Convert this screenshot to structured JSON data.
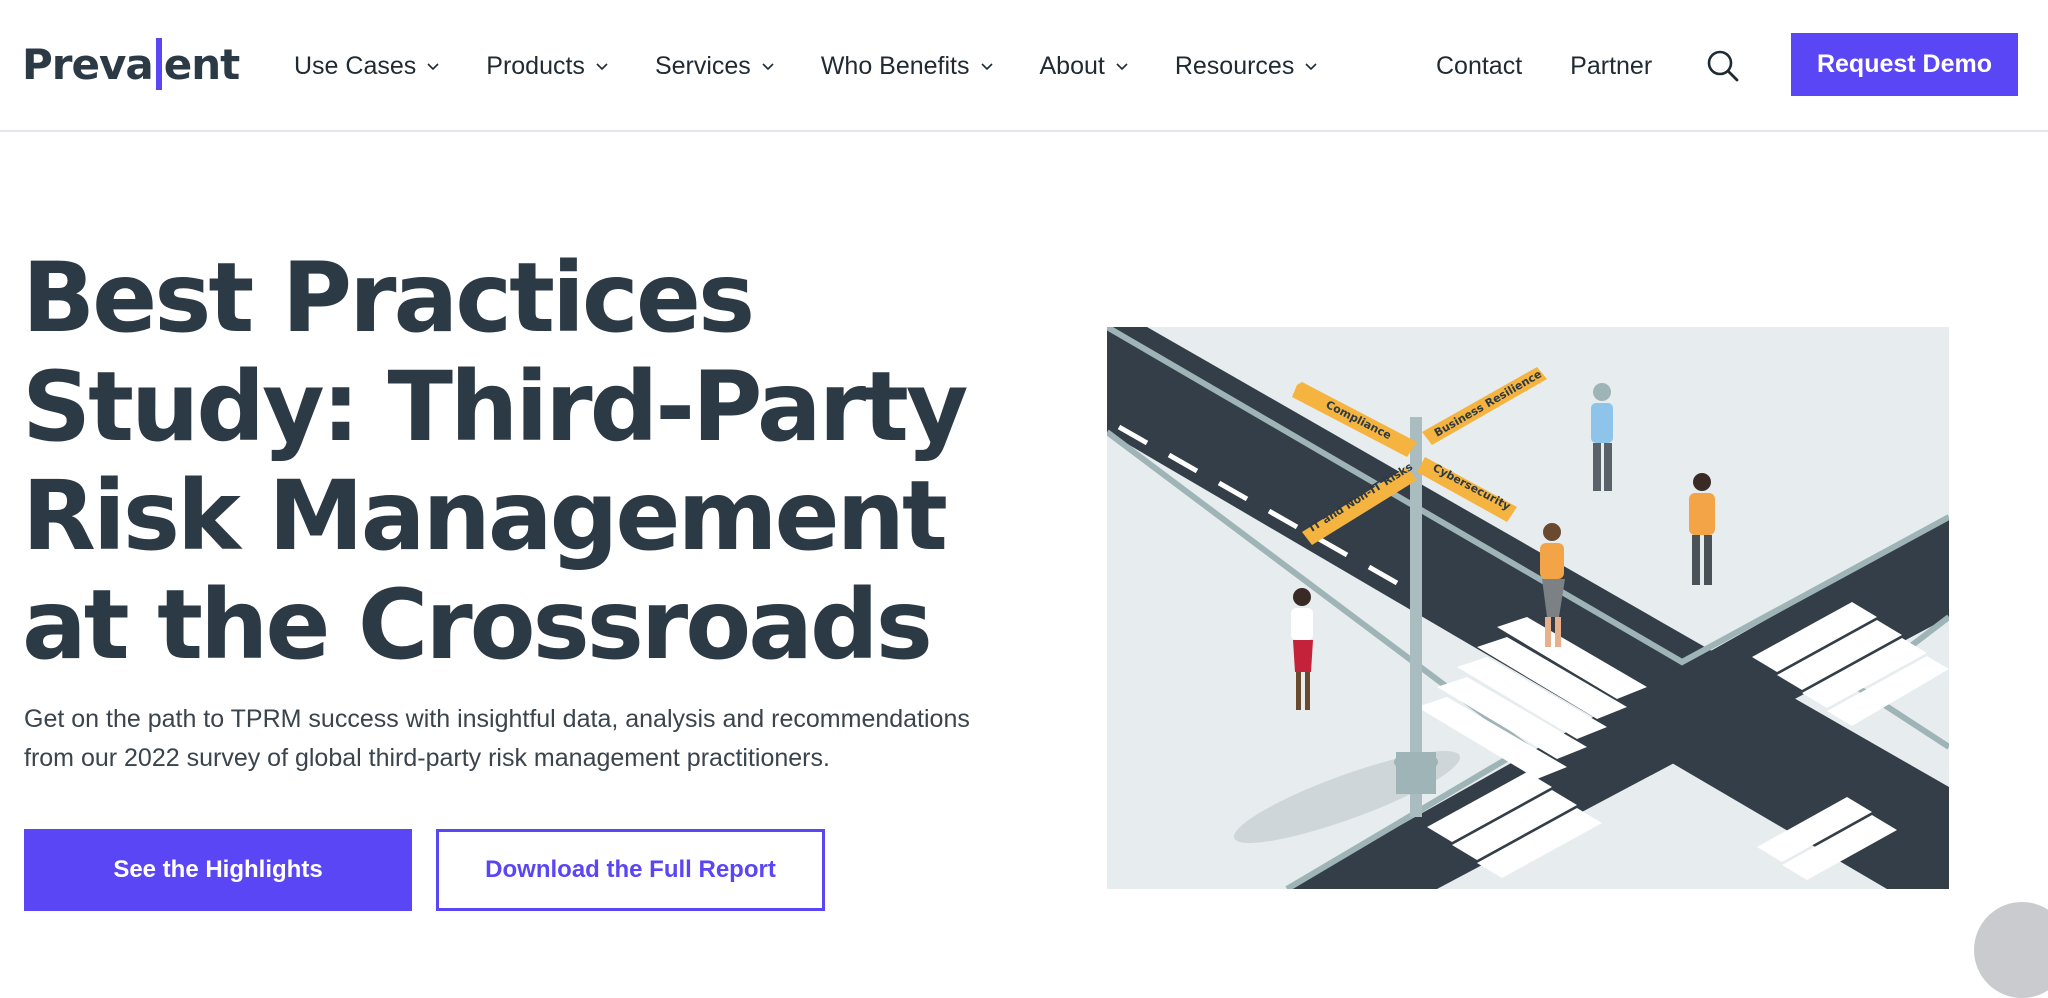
{
  "logo": {
    "part1": "Preva",
    "part2": "ent"
  },
  "nav": {
    "items": [
      {
        "label": "Use Cases"
      },
      {
        "label": "Products"
      },
      {
        "label": "Services"
      },
      {
        "label": "Who Benefits"
      },
      {
        "label": "About"
      },
      {
        "label": "Resources"
      }
    ],
    "contact": "Contact",
    "partner": "Partner",
    "cta": "Request Demo"
  },
  "hero": {
    "title": "Best Practices Study: Third-Party Risk Management at the Crossroads",
    "subtitle": "Get on the path to TPRM success with insightful data, analysis and recommendations from our 2022 survey of global third-party risk management practitioners.",
    "primary_button": "See the Highlights",
    "secondary_button": "Download the Full Report"
  },
  "illustration": {
    "signs": [
      "Compliance",
      "Business Resilience",
      "IT and Non-IT Risks",
      "Cybersecurity"
    ]
  },
  "colors": {
    "accent": "#5b46f6",
    "text": "#2c3a45"
  }
}
